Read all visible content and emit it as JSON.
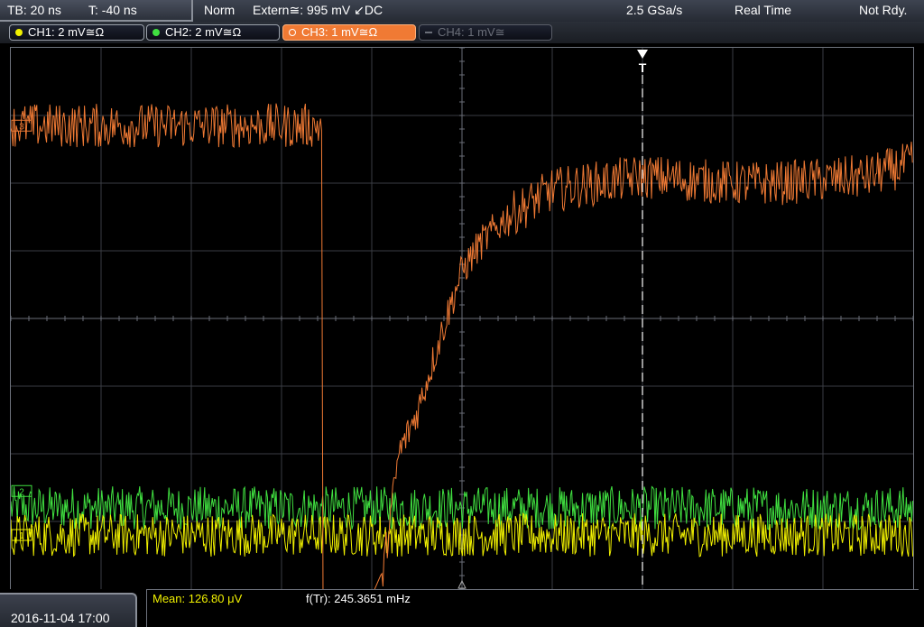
{
  "topbar": {
    "timebase": "TB: 20 ns",
    "trigger_time": "T: -40 ns",
    "trigger_mode": "Norm",
    "trigger_source": "Extern≅: 995 mV ↙DC",
    "sample_rate": "2.5 GSa/s",
    "acq_mode": "Real Time",
    "status": "Not Rdy."
  },
  "channels": [
    {
      "label": "CH1: 2 mV≅Ω",
      "color": "#f0f000",
      "state": "on"
    },
    {
      "label": "CH2: 2 mV≅Ω",
      "color": "#40e040",
      "state": "on"
    },
    {
      "label": "CH3: 1 mV≅Ω",
      "color": "#f07a34",
      "state": "active"
    },
    {
      "label": "CH4: 1 mV≅",
      "color": "#6a6e78",
      "state": "off"
    }
  ],
  "trigger_marker": {
    "label": "T"
  },
  "channel_markers": [
    "1",
    "2",
    "3"
  ],
  "bottombar": {
    "datetime": "2016-11-04 17:00",
    "measurement_1": "Mean: 126.80 μV",
    "measurement_2": "f(Tr): 245.3651 mHz"
  },
  "colors": {
    "ch1": "#f0f000",
    "ch2": "#40e040",
    "ch3": "#f07a34",
    "grid": "#3a3d44",
    "grid_center": "#6a6e78"
  },
  "chart_data": {
    "type": "line",
    "divisions_x": 10,
    "divisions_y": 8,
    "x_range_div": [
      0,
      10
    ],
    "y_range_div": [
      0,
      8
    ],
    "grid": true,
    "trigger_x_div": 7.0,
    "series": [
      {
        "channel": "CH3",
        "noise_div": 0.33,
        "segments": [
          {
            "x": [
              0.0,
              3.45
            ],
            "y": [
              6.85,
              6.85
            ]
          },
          {
            "x": [
              3.45,
              3.46
            ],
            "y": [
              6.85,
              -0.2
            ]
          },
          {
            "x": [
              4.1,
              4.3,
              4.5,
              4.8,
              5.0,
              5.2,
              5.5,
              6.0,
              6.5,
              7.0,
              7.5,
              8.0,
              8.5,
              9.0,
              9.5,
              10.0
            ],
            "y": [
              0.0,
              2.0,
              2.6,
              3.9,
              4.7,
              5.1,
              5.5,
              5.9,
              6.0,
              6.1,
              6.05,
              6.0,
              6.0,
              6.05,
              6.1,
              6.3
            ]
          }
        ]
      },
      {
        "channel": "CH2",
        "mean_div": 1.2,
        "noise_div": 0.32,
        "x": [
          0,
          10
        ]
      },
      {
        "channel": "CH1",
        "mean_div": 0.8,
        "noise_div": 0.32,
        "x": [
          0,
          10
        ]
      }
    ]
  }
}
